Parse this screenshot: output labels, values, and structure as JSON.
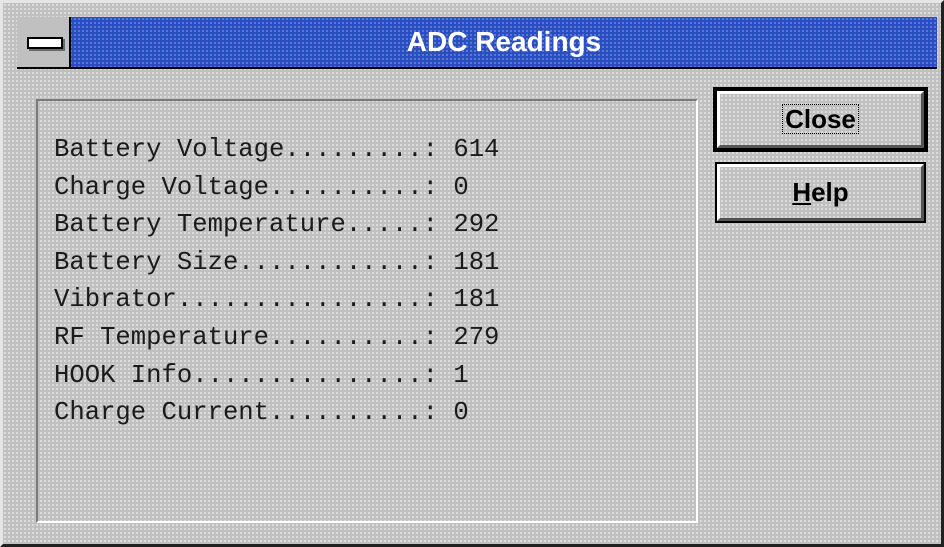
{
  "window": {
    "title": "ADC Readings"
  },
  "readings": [
    {
      "label": "Battery Voltage.........",
      "value": "614"
    },
    {
      "label": "Charge Voltage..........",
      "value": "0"
    },
    {
      "label": "Battery Temperature.....",
      "value": "292"
    },
    {
      "label": "Battery Size............",
      "value": "181"
    },
    {
      "label": "Vibrator................",
      "value": "181"
    },
    {
      "label": "RF Temperature..........",
      "value": "279"
    },
    {
      "label": "HOOK Info...............",
      "value": "1"
    },
    {
      "label": "Charge Current..........",
      "value": "0"
    }
  ],
  "buttons": {
    "close_label": "Close",
    "help_hotkey": "H",
    "help_rest": "elp"
  },
  "colors": {
    "titlebar": "#2a4dbf",
    "face": "#c0c0c0",
    "title_text": "#ffffff"
  },
  "icons": {
    "system_menu": "system-menu-icon"
  }
}
